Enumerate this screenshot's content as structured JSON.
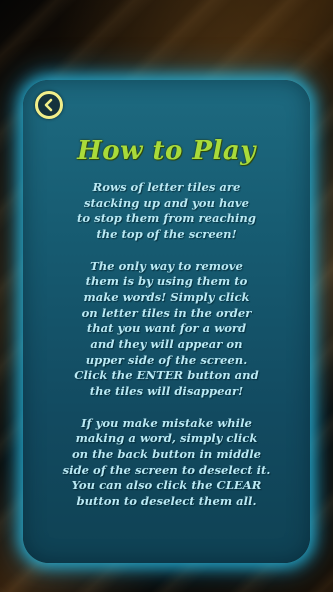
{
  "screen": {
    "title": "How to Play",
    "back_button_icon": "chevron-left-icon",
    "paragraphs": [
      "Rows of letter tiles are\nstacking up and you have\nto stop them from reaching\nthe top of the screen!",
      "The only way to remove\nthem is by using them to\nmake words!  Simply click\non letter tiles in the order\nthat you want for a word\nand they will appear on\nupper side of the screen.\nClick the ENTER button and\nthe tiles will disappear!",
      "If you make mistake while\nmaking a word, simply click\non the back button in middle\nside of the screen to deselect it.\nYou can also click the CLEAR\nbutton to deselect them all."
    ]
  },
  "colors": {
    "panel": "#165a70",
    "panel_glow": "#28bee6",
    "title": "#a9db3a",
    "text": "#b9e9f4",
    "back_button_ring": "#f2ef8a"
  }
}
